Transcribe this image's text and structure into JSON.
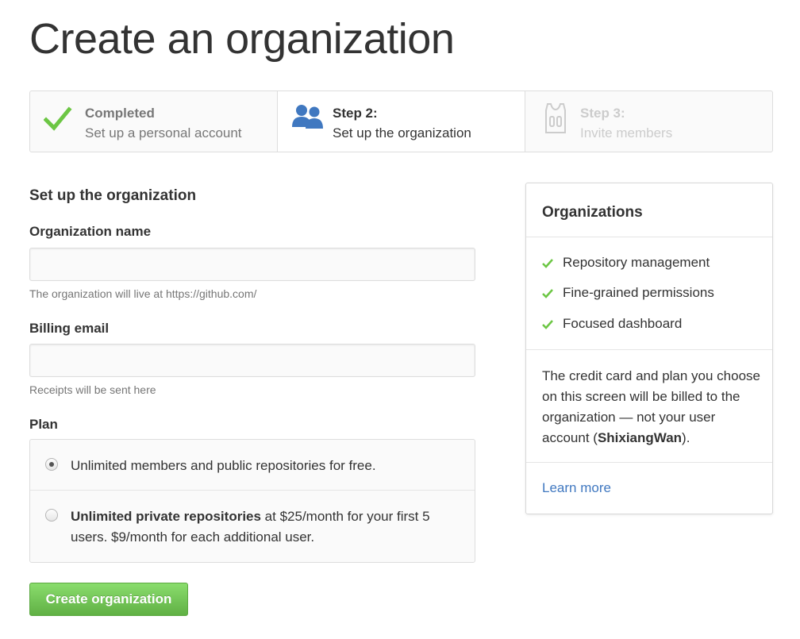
{
  "page": {
    "title": "Create an organization"
  },
  "steps": [
    {
      "icon": "checkmark-icon",
      "title": "Completed",
      "desc": "Set up a personal account",
      "state": "complete"
    },
    {
      "icon": "people-icon",
      "title": "Step 2:",
      "desc": "Set up the organization",
      "state": "current"
    },
    {
      "icon": "jersey-icon",
      "title": "Step 3:",
      "desc": "Invite members",
      "state": "future"
    }
  ],
  "form": {
    "heading": "Set up the organization",
    "org_name": {
      "label": "Organization name",
      "value": "",
      "placeholder": "",
      "note": "The organization will live at https://github.com/"
    },
    "billing_email": {
      "label": "Billing email",
      "value": "",
      "placeholder": "",
      "note": "Receipts will be sent here"
    },
    "plan": {
      "label": "Plan",
      "options": [
        {
          "bold": "",
          "text": "Unlimited members and public repositories for free.",
          "selected": true
        },
        {
          "bold": "Unlimited private repositories",
          "text": " at $25/month for your first 5 users. $9/month for each additional user.",
          "selected": false
        }
      ]
    },
    "submit_label": "Create organization"
  },
  "sidebar": {
    "title": "Organizations",
    "features": [
      "Repository management",
      "Fine-grained permissions",
      "Focused dashboard"
    ],
    "note": {
      "before": "The credit card and plan you choose on this screen will be billed to the organization — not your user account (",
      "username": "ShixiangWan",
      "after": ")."
    },
    "learn_more": "Learn more"
  },
  "colors": {
    "accent_green": "#6cc644",
    "button_green": "#60b044",
    "link_blue": "#4078c0",
    "people_blue": "#4078c0"
  }
}
